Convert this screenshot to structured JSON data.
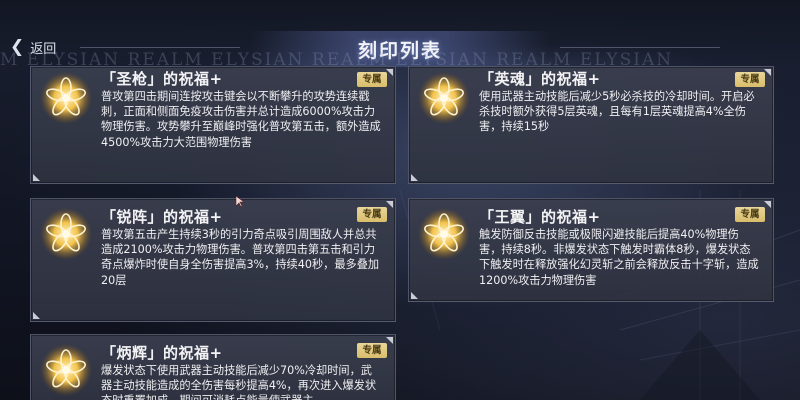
{
  "header": {
    "back_label": "返回",
    "title": "刻印列表"
  },
  "watermark": "M   ELYSIAN REALM      ELYSIAN REALM      ELYSIAN REALM      ELYSIAN",
  "cards": [
    {
      "title": "「圣枪」的祝福+",
      "badge": "专属",
      "description": "普攻第四击期间连按攻击键会以不断攀升的攻势连续戳刺，正面和侧面免疫攻击伤害并总计造成6000%攻击力物理伤害。攻势攀升至巅峰时强化普攻第五击，额外造成4500%攻击力大范围物理伤害"
    },
    {
      "title": "「英魂」的祝福+",
      "badge": "专属",
      "description": "使用武器主动技能后减少5秒必杀技的冷却时间。开启必杀技时额外获得5层英魂，且每有1层英魂提高4%全伤害，持续15秒"
    },
    {
      "title": "「锐阵」的祝福+",
      "badge": "专属",
      "description": "普攻第五击产生持续3秒的引力奇点吸引周围敌人并总共造成2100%攻击力物理伤害。普攻第四击第五击和引力奇点爆炸时使自身全伤害提高3%，持续40秒，最多叠加20层"
    },
    {
      "title": "「王翼」的祝福+",
      "badge": "专属",
      "description": "触发防御反击技能或极限闪避技能后提高40%物理伤害，持续8秒。非爆发状态下触发时霸体8秒，爆发状态下触发时在释放强化幻灵斩之前会释放反击十字斩，造成1200%攻击力物理伤害"
    },
    {
      "title": "「炳辉」的祝福+",
      "badge": "专属",
      "description": "爆发状态下使用武器主动技能后减少70%冷却时间，武器主动技能造成的全伤害每秒提高4%，再次进入爆发状态时重置加成。期间可消耗点能量使武器主"
    }
  ]
}
